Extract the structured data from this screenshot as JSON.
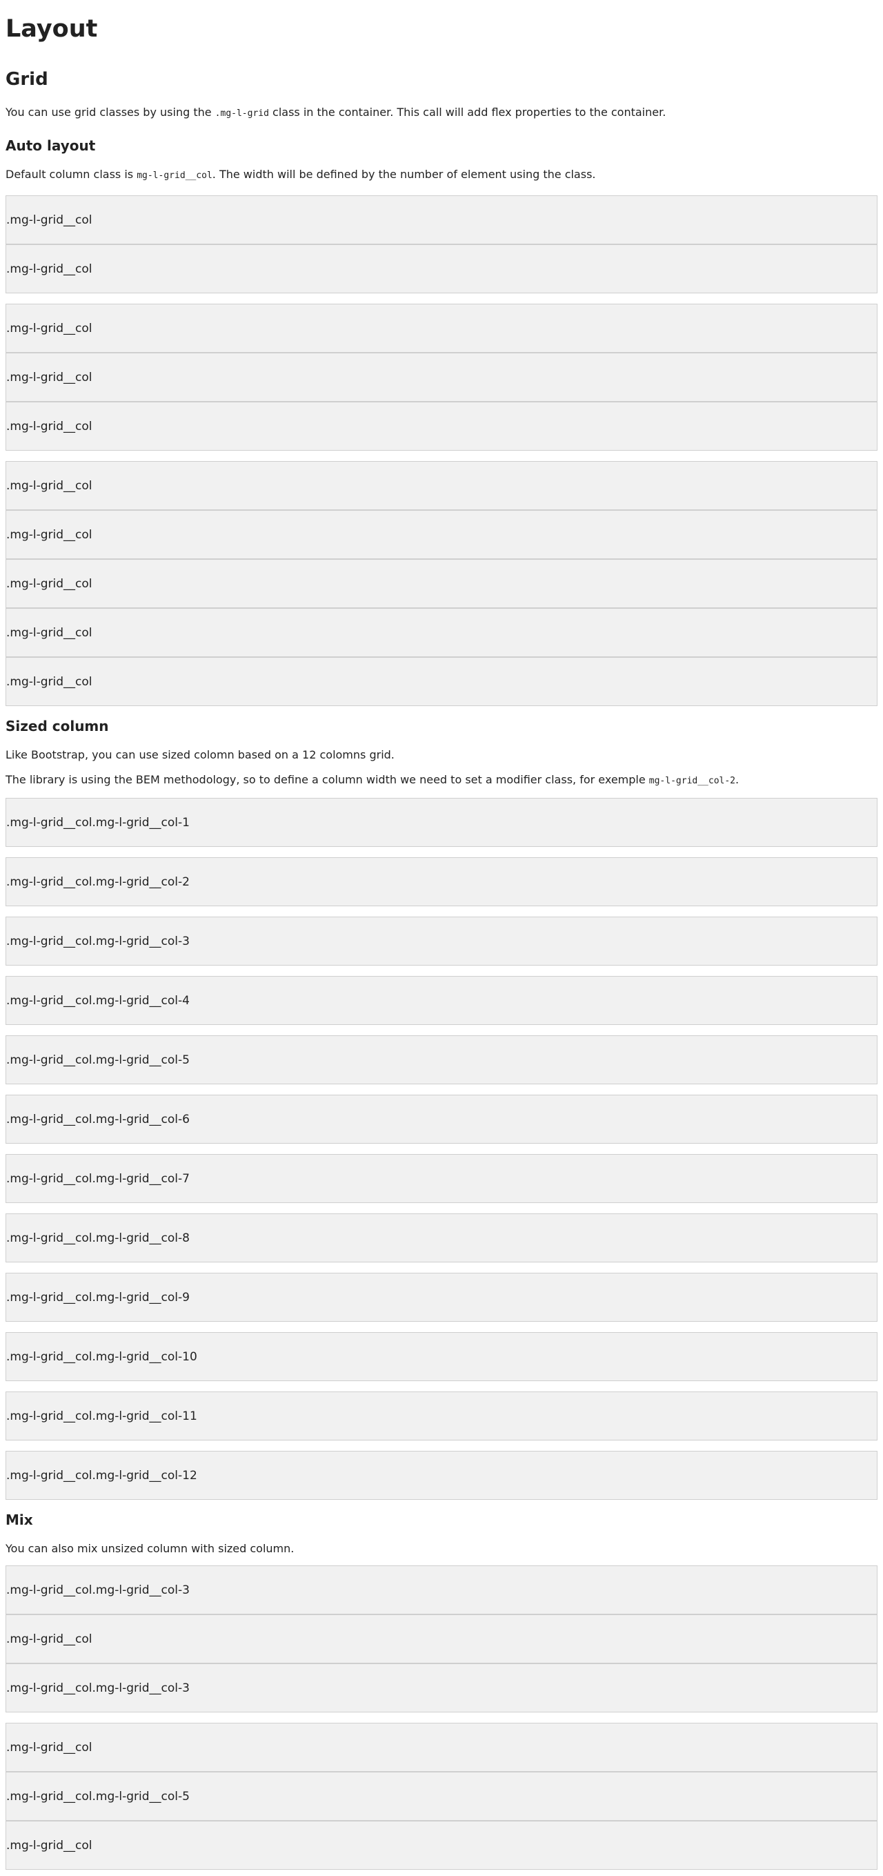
{
  "title": "Layout",
  "grid": {
    "heading": "Grid",
    "intro_pre": "You can use grid classes by using the ",
    "intro_code": ".mg-l-grid",
    "intro_post": " class in the container. This call will add flex properties to the container."
  },
  "auto": {
    "heading": "Auto layout",
    "desc_pre": "Default column class is ",
    "desc_code": "mg-l-grid__col",
    "desc_post": ". The width will be defined by the number of element using the class.",
    "col_label": ".mg-l-grid__col"
  },
  "sized": {
    "heading": "Sized column",
    "p1": "Like Bootstrap, you can use sized colomn based on a 12 colomns grid.",
    "p2_pre": "The library is using the BEM methodology, so to define a column width we need to set a modifier class, for exemple ",
    "p2_code": "mg-l-grid__col-2",
    "p2_post": ".",
    "labels": [
      ".mg-l-grid__col.mg-l-grid__col-1",
      ".mg-l-grid__col.mg-l-grid__col-2",
      ".mg-l-grid__col.mg-l-grid__col-3",
      ".mg-l-grid__col.mg-l-grid__col-4",
      ".mg-l-grid__col.mg-l-grid__col-5",
      ".mg-l-grid__col.mg-l-grid__col-6",
      ".mg-l-grid__col.mg-l-grid__col-7",
      ".mg-l-grid__col.mg-l-grid__col-8",
      ".mg-l-grid__col.mg-l-grid__col-9",
      ".mg-l-grid__col.mg-l-grid__col-10",
      ".mg-l-grid__col.mg-l-grid__col-11",
      ".mg-l-grid__col.mg-l-grid__col-12"
    ]
  },
  "mix": {
    "heading": "Mix",
    "desc": "You can also mix unsized column with sized column.",
    "group1": [
      ".mg-l-grid__col.mg-l-grid__col-3",
      ".mg-l-grid__col",
      ".mg-l-grid__col.mg-l-grid__col-3"
    ],
    "group2": [
      ".mg-l-grid__col",
      ".mg-l-grid__col.mg-l-grid__col-5",
      ".mg-l-grid__col"
    ]
  }
}
